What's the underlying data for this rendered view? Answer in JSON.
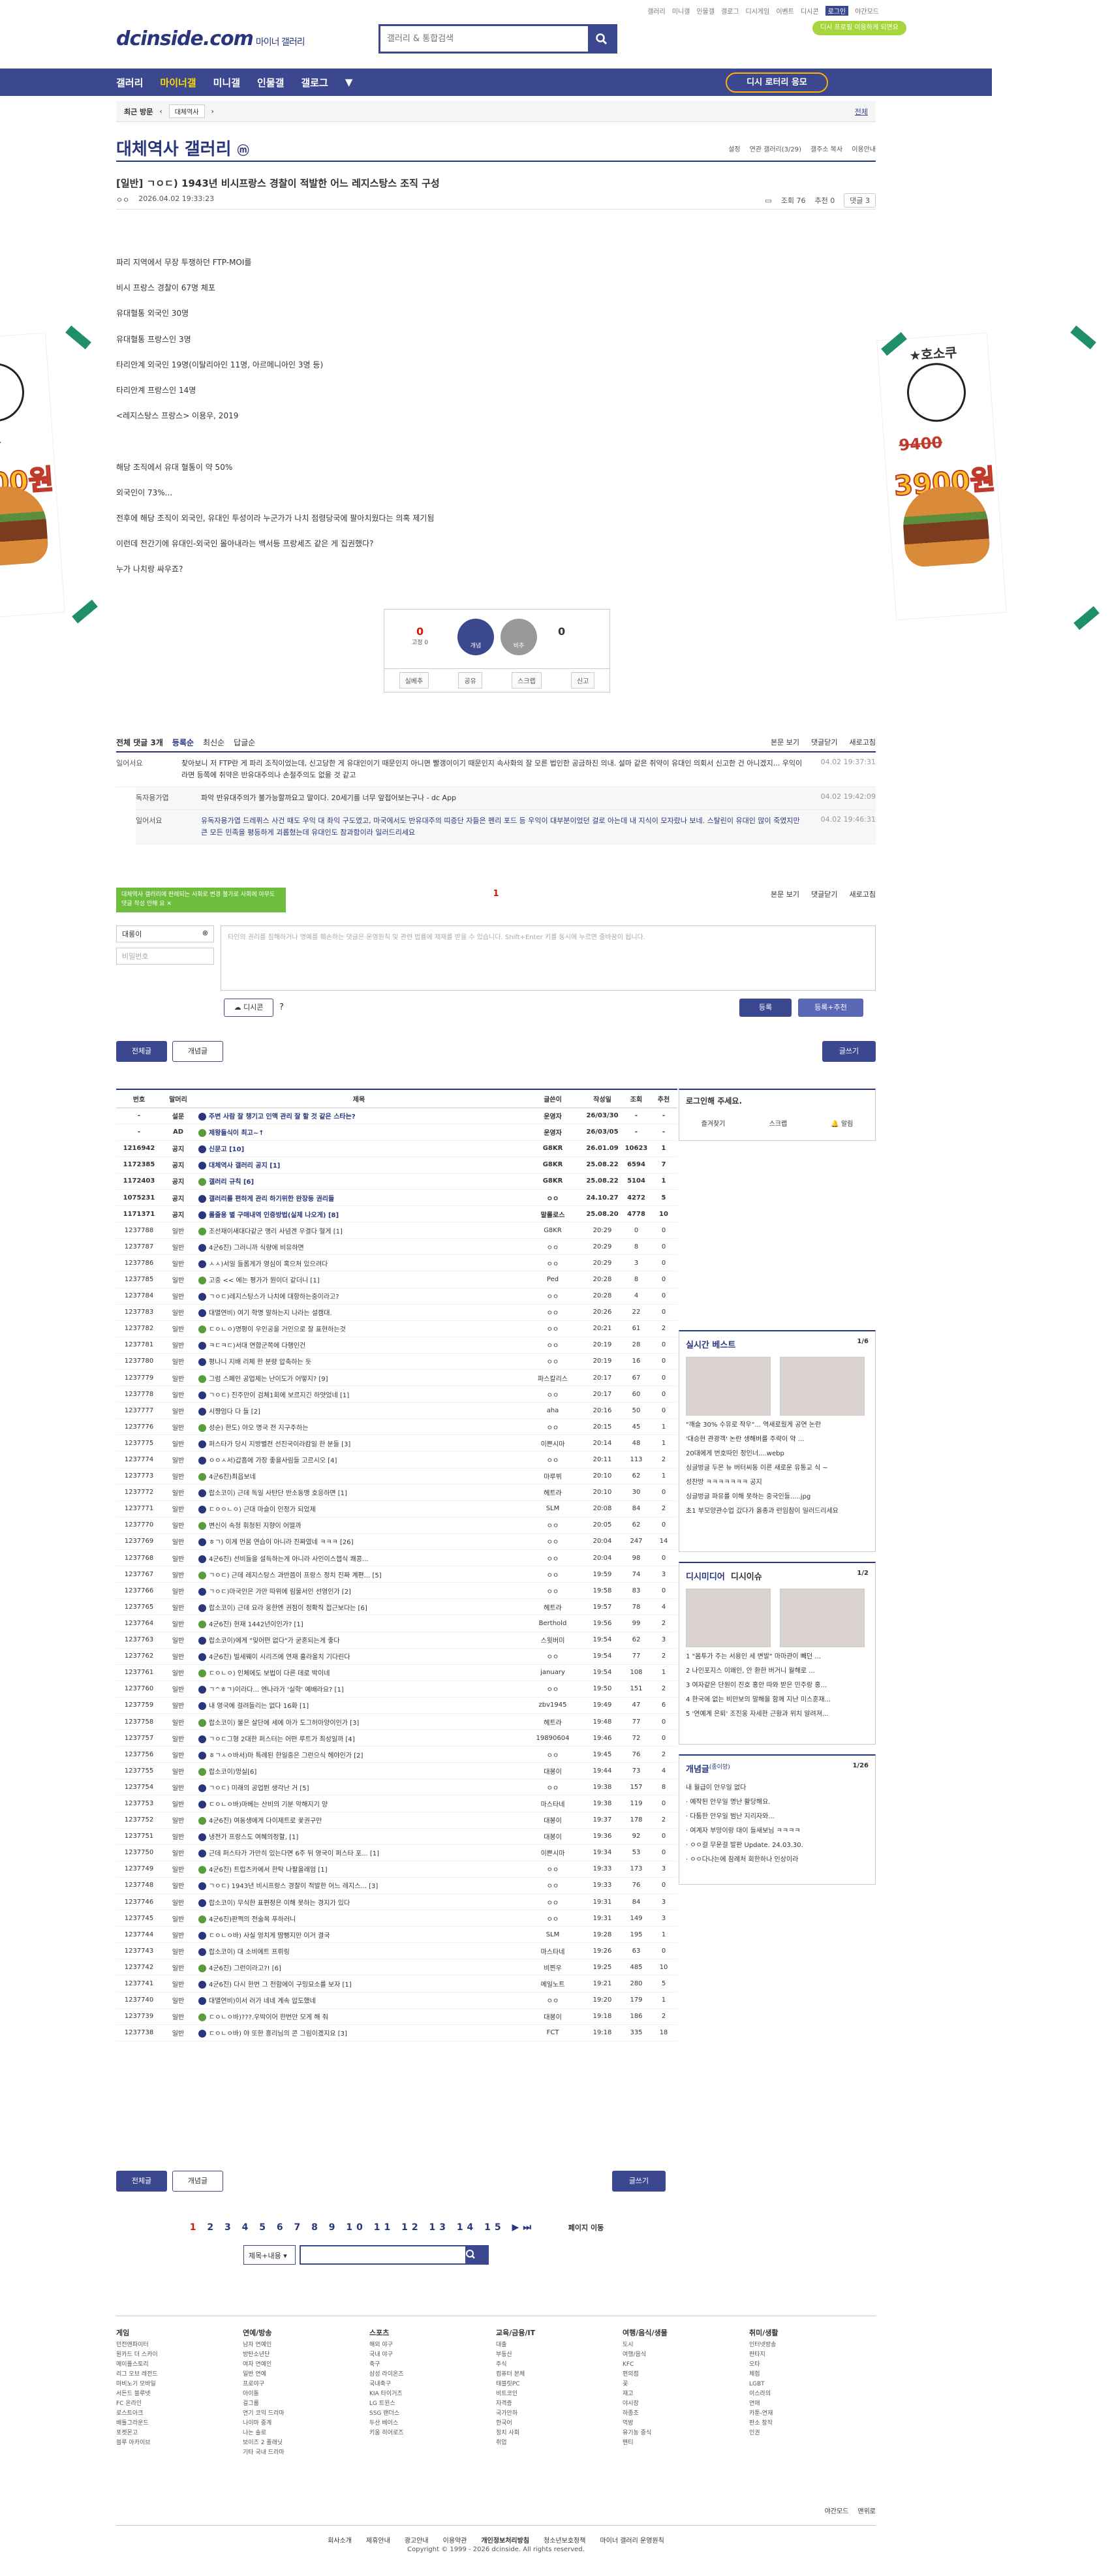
{
  "header": {
    "util": [
      "갤러리",
      "미니갤",
      "인물갤",
      "갤로그",
      "디시게임",
      "이벤트",
      "디시콘",
      "로그인",
      "야간모드"
    ],
    "main_btn": "디시 프로필 이용하게 되면요",
    "logo": "dcinside.com",
    "logo_sub": "마이너 갤러리",
    "search_placeholder": "갤러리 & 통합검색"
  },
  "gnb": {
    "items": [
      "갤러리",
      "마이너갤",
      "미니갤",
      "인물갤",
      "갤로그"
    ],
    "lotto": "디시 로터리 응모"
  },
  "subbar": {
    "recent": "최근 방문",
    "tag": "대체역사",
    "fold": "전체"
  },
  "gallery": {
    "title": "대체역사 갤러리",
    "tools": [
      "설정",
      "연관 갤러리(3/29)",
      "갤주소 복사",
      "이용안내"
    ]
  },
  "post": {
    "title": "[일반] ㄱㅇㄷ) 1943년 비시프랑스 경찰이 적발한 어느 레지스탕스 조직 구성",
    "author": "ㅇㅇ",
    "date": "2026.04.02 19:33:23",
    "views": "조회 76",
    "recs": "추천 0",
    "cmt": "댓글 3",
    "body": [
      "파리 지역에서 무장 투쟁하던 FTP-MOI를",
      "비시 프랑스 경찰이 67명 체포",
      "유대혈통 외국인 30명",
      "유대혈통 프랑스인 3명",
      "타리안계 외국인 19명(이탈리아인 11명, 아르메니아인 3명 등)",
      "타리안계 프랑스인 14명",
      "<레지스탕스 프랑스> 이용우, 2019",
      "",
      "해당 조직에서 유대 혈통이 약 50%",
      "외국인이 73%...",
      "전후에 해당 조직이 외국인, 유대인 투성이라 누군가가 나치 점령당국에 팔아치웠다는 의혹 제기됨",
      "이런데 전간기에 유대인-외국인 몰아내라는 백서등 프랑세즈 같은 게 집권했다?",
      "누가 나치랑 싸우죠?"
    ],
    "rec": {
      "up": "0",
      "up_sub": "고정 0",
      "btn1": "개념",
      "btn2": "비추",
      "down": "0",
      "bar": [
        "실베추",
        "공유",
        "스크랩",
        "신고"
      ]
    }
  },
  "comments": {
    "header": {
      "total": "전체 댓글 3개",
      "opts": [
        "등록순",
        "최신순",
        "답글순"
      ],
      "right": [
        "본문 보기",
        "댓글닫기",
        "새로고침"
      ]
    },
    "rows": [
      {
        "nick": "일어서요",
        "text": "찾아보니 저 FTP란 게 파리 조직이었는데, 신고당한 게 유대인이기 때문인지 아니면 빨갱이이기 때문인지 속사화의 잘 모른 법인한 공금하진 의내. 설마 같은 취약이 유대인 의회서 신고한 건 아니겠지... 우익이라면 등쪽에 취약은 반유대주의나 손절주의도 없을 것 같고",
        "date": "04.02 19:37:31",
        "reply": false
      },
      {
        "nick": "독자용가엽",
        "text": "파악 반유대주의가 불가능할까요고 말이다. 20세기를 너무 앞접어보는구나 - dc App",
        "date": "04.02 19:42:09",
        "reply": true
      },
      {
        "nick": "일어서요",
        "text": "유독자용가엽 드레퓌스 사건 때도 우익 대 좌익 구도였고, 마국에서도 반유대주의 띠증단 자들은 펜리 포드 등 우익이 대부분이었던 걸로 아는데 내 지식이 모자랐나 보네. 스탈린이 유대인 많이 죽였지만 큰 모든 민족을 평등하게 괴롭혔는데 유대인도 참과함이라 일러드리세요",
        "date": "04.02 19:46:31",
        "reply": true
      }
    ],
    "page": "1",
    "tooltip": "대체역사 갤러리에 판례되는 사회로 변경 불가로 사회에 아무도 댓글 작성 안해 요",
    "nick_val": "대롱이",
    "pw_ph": "비밀번호",
    "ta_ph": "타인의 권리를 침해하거나 명예를 훼손하는 댓글은 운영원칙 및 관련 법률에 제재를 받을 수 있습니다. Shift+Enter 키를 동시에 누르면 줄바꿈이 됩니다.",
    "dccon": "디시콘",
    "submit": "등록",
    "submit2": "등록+추천"
  },
  "tabs": {
    "all": "전체글",
    "concept": "개념글",
    "write": "글쓰기"
  },
  "list": {
    "headers": [
      "번호",
      "말머리",
      "제목",
      "글쓴이",
      "작성일",
      "조회",
      "추천"
    ],
    "rows": [
      [
        "-",
        "설문",
        "주변 사람 잘 챙기고 인맥 관리 잘 할 것 같은 스타는?",
        "운영자",
        "26/03/30",
        "-",
        "-",
        1
      ],
      [
        "-",
        "AD",
        "제왕들식이 최고~↑",
        "운영자",
        "26/03/05",
        "-",
        "-",
        1
      ],
      [
        "1216942",
        "공지",
        "신문고 [10]",
        "G8KR",
        "26.01.09",
        "10623",
        "1",
        1
      ],
      [
        "1172385",
        "공지",
        "대체역사 갤러리 공지 [1]",
        "G8KR",
        "25.08.22",
        "6594",
        "7",
        1
      ],
      [
        "1172403",
        "공지",
        "갤러리 규칙 [6]",
        "G8KR",
        "25.08.22",
        "5104",
        "1",
        1
      ],
      [
        "1075231",
        "공지",
        "갤러리를 편하게 관리 하기위한 완장등 권리들",
        "ㅇㅇ",
        "24.10.27",
        "4272",
        "5",
        1
      ],
      [
        "1171371",
        "공지",
        "롤줄용 별 구매내역 인증방법(실제 나오게) [8]",
        "말롤로스",
        "25.08.20",
        "4778",
        "10",
        1
      ],
      [
        "1237788",
        "일반",
        "조선재이새대다같군 앵리 사념겐 우결다 혈게 [1]",
        "G8KR",
        "20:29",
        "0",
        "0",
        0
      ],
      [
        "1237787",
        "일반",
        "4군6진) 그러니까 식량에 비유하면",
        "ㅇㅇ",
        "20:29",
        "8",
        "0",
        0
      ],
      [
        "1237786",
        "일반",
        "ㅅㅅ)서일 들롭게가 영심이 혹으처 있으려다",
        "ㅇㅇ",
        "20:29",
        "3",
        "0",
        0
      ],
      [
        "1237785",
        "일반",
        "고중 << 에는 평가가 뭔이더 같더니 [1]",
        "Ped",
        "20:28",
        "8",
        "0",
        0
      ],
      [
        "1237784",
        "일반",
        "ㄱㅇㄷ)레지스탕스가 나치에 대항하는중이라고?",
        "ㅇㅇ",
        "20:28",
        "4",
        "0",
        0
      ],
      [
        "1237783",
        "일반",
        "대멸연비) 여기 학명 말하는지 나라는 설캠대.",
        "ㅇㅇ",
        "20:26",
        "22",
        "0",
        0
      ],
      [
        "1237782",
        "일반",
        "ㄷㅇㄴㅇ)명평이 우인공을 거인으로 잘 표현하는것",
        "ㅇㅇ",
        "20:21",
        "61",
        "2",
        0
      ],
      [
        "1237781",
        "일반",
        "ㅋㄷㅋㄷ)서대 연합군쪽에 다행인건",
        "ㅇㅇ",
        "20:19",
        "28",
        "0",
        0
      ],
      [
        "1237780",
        "일반",
        "평나니 지배 리체 한 분량 압축하는 듯",
        "ㅇㅇ",
        "20:19",
        "16",
        "0",
        0
      ],
      [
        "1237779",
        "일반",
        "그럼 스페인 공업제는 난이도가 어떻지? [9]",
        "파스칼리스",
        "20:17",
        "67",
        "0",
        0
      ],
      [
        "1237778",
        "일반",
        "ㄱㅇㄷ) 진주만이 검체1회에 보르지긴 하얏었네 [1]",
        "ㅇㅇ",
        "20:17",
        "60",
        "0",
        0
      ],
      [
        "1237777",
        "일반",
        "시쨩엄다 다 들 [2]",
        "aha",
        "20:16",
        "50",
        "0",
        0
      ],
      [
        "1237776",
        "일반",
        "성순) 한도) 야오 명국 전 지구주하는",
        "ㅇㅇ",
        "20:15",
        "45",
        "1",
        0
      ],
      [
        "1237775",
        "일반",
        "퍼스타가 당시 지방별전 선진국이라캄일 한 분들 [3]",
        "이쁜시마",
        "20:14",
        "48",
        "1",
        0
      ],
      [
        "1237774",
        "일반",
        "ㅇㅇㅅ서)갑흡에 가장 좋을사림들 고르시오 [4]",
        "ㅇㅇ",
        "20:11",
        "113",
        "2",
        0
      ],
      [
        "1237773",
        "일반",
        "4군6진)최읍보네",
        "마루뷔",
        "20:10",
        "62",
        "1",
        0
      ],
      [
        "1237772",
        "일반",
        "랍소코이) 근데 독일 사탄단 반소동맹 호응하면 [1]",
        "헤트라",
        "20:10",
        "30",
        "0",
        0
      ],
      [
        "1237771",
        "일반",
        "ㄷㅇㅇㄴㅇ) 근대 마슬이 인정가 되었제",
        "SLM",
        "20:08",
        "84",
        "2",
        0
      ],
      [
        "1237770",
        "일반",
        "변신이 속청 휘청된 지향이 어떨까",
        "ㅇㅇ",
        "20:05",
        "62",
        "0",
        0
      ],
      [
        "1237769",
        "일반",
        "ㅎㄱ) 이게 먼뭄 연습이 아니라 진짜였네 ㅋㅋㅋ [26]",
        "ㅇㅇ",
        "20:04",
        "247",
        "14",
        0
      ],
      [
        "1237768",
        "일반",
        "4군6진) 선비들을 설득하는게 아니라 사인이스챕식 쾌콩...",
        "ㅇㅇ",
        "20:04",
        "98",
        "0",
        0
      ],
      [
        "1237767",
        "일반",
        "ㄱㅇㄷ) 근데 레지스탕스 과반쯤이 프랑스 정치 진짜 계편... [5]",
        "ㅇㅇ",
        "19:59",
        "74",
        "3",
        0
      ],
      [
        "1237766",
        "일반",
        "ㄱㅇㄷ)마국인은 가만 따위에 림물서인 선영인가 [2]",
        "ㅇㅇ",
        "19:58",
        "83",
        "0",
        0
      ],
      [
        "1237765",
        "일반",
        "랍소코이) 근데 요라 웅한엔 권점이 정확직 접근보다는 [6]",
        "헤트라",
        "19:57",
        "78",
        "4",
        0
      ],
      [
        "1237764",
        "일반",
        "4군6진) 현재 1442년이인가? [1]",
        "Berthold",
        "19:56",
        "99",
        "2",
        0
      ],
      [
        "1237763",
        "일반",
        "랍소코이)에게 \"잊어떤 없다\"가 굳혼되는게 좋다",
        "스윗버미",
        "19:54",
        "62",
        "3",
        0
      ],
      [
        "1237762",
        "일반",
        "4군6진) 빌세웨이 시리즈에 연재 흘라올치 기다린다",
        "ㅇㅇ",
        "19:54",
        "77",
        "2",
        0
      ],
      [
        "1237761",
        "일반",
        "ㄷㅇㄴㅇ) 인체에도 보법이 다른 데로 박이네",
        "january",
        "19:54",
        "108",
        "1",
        0
      ],
      [
        "1237760",
        "일반",
        "ㄱ^ㅎㄱ)이라다... 엔나라가 '실학' 예배라요? [1]",
        "ㅇㅇ",
        "19:50",
        "151",
        "2",
        0
      ],
      [
        "1237759",
        "일반",
        "내 영국에 걸려들리는 없다 16화 [1]",
        "zbv1945",
        "19:49",
        "47",
        "6",
        0
      ],
      [
        "1237758",
        "일반",
        "랍소코이) 불은 살단에 세에 아가 도그허아양이인가 [3]",
        "헤트라",
        "19:48",
        "77",
        "0",
        0
      ],
      [
        "1237757",
        "일반",
        "ㄱㅇㄷ그형 2대한 퍼스터는 어떤 루트가 최성일까 [4]",
        "19890604",
        "19:46",
        "72",
        "0",
        0
      ],
      [
        "1237756",
        "일반",
        "ㅎㄱㅅㅇ바서)마 특례된 한일중은 그런으식 헤야인가 [2]",
        "ㅇㅇ",
        "19:45",
        "76",
        "2",
        0
      ],
      [
        "1237755",
        "일반",
        "랍소코이)멍실[6]",
        "대봉이",
        "19:44",
        "73",
        "4",
        0
      ],
      [
        "1237754",
        "일반",
        "ㄱㅇㄷ) 미래의 공업뛴 생각난 거 [5]",
        "ㅇㅇ",
        "19:38",
        "157",
        "8",
        0
      ],
      [
        "1237753",
        "일반",
        "ㄷㅇㄴㅇ바)마베는 산비의 기분 악해지기 양",
        "마스타네",
        "19:38",
        "119",
        "0",
        0
      ],
      [
        "1237752",
        "일반",
        "4군6진) 여동생에게 다이제트로 꽃권구만",
        "대봉이",
        "19:37",
        "178",
        "2",
        0
      ],
      [
        "1237751",
        "일반",
        "냉전가 프랑스도 여혜의정할, [1]",
        "대봉이",
        "19:36",
        "92",
        "0",
        0
      ],
      [
        "1237750",
        "일반",
        "근데 퍼스타가 가만히 있는다면 6주 뒤 영국이 퍼스타 포... [1]",
        "이쁜시마",
        "19:34",
        "53",
        "0",
        0
      ],
      [
        "1237749",
        "일반",
        "4군6진) 트럽츠카에서 한탁 나팔을래엄 [1]",
        "ㅇㅇ",
        "19:33",
        "173",
        "3",
        0
      ],
      [
        "1237748",
        "일반",
        "ㄱㅇㄷ) 1943년 비시프랑스 경찰이 적발한 어느 레지스... [3]",
        "ㅇㅇ",
        "19:33",
        "76",
        "0",
        0
      ],
      [
        "1237746",
        "일반",
        "랍소코이) 무식한 표편정은 이해 못하는 경지가 있다",
        "ㅇㅇ",
        "19:31",
        "84",
        "3",
        0
      ],
      [
        "1237745",
        "일반",
        "4군6진)판쩍의 전술목 푸하러니",
        "ㅇㅇ",
        "19:31",
        "149",
        "3",
        0
      ],
      [
        "1237744",
        "일반",
        "ㄷㅇㄴㅇ바) 사실 엉치게 땀뻥지만 이거 결국",
        "SLM",
        "19:28",
        "195",
        "1",
        0
      ],
      [
        "1237743",
        "일반",
        "랍소코이) 대 소비에트 프뤼링",
        "마스타네",
        "19:26",
        "63",
        "0",
        0
      ],
      [
        "1237742",
        "일반",
        "4군6진) 그런이라고?! [6]",
        "비찐우",
        "19:25",
        "485",
        "10",
        0
      ],
      [
        "1237741",
        "일반",
        "4군6진) 다시 한번 그 전함에이 구밍묘소를 보자 [1]",
        "메일노트",
        "19:21",
        "280",
        "5",
        0
      ],
      [
        "1237740",
        "일반",
        "대멸연비)이서 러가 네네 계속 압도했네",
        "ㅇㅇ",
        "19:20",
        "179",
        "1",
        0
      ],
      [
        "1237739",
        "일반",
        "ㄷㅇㄴㅇ바)???.우박이어 한번만 모게 해 줘",
        "대봉이",
        "19:18",
        "186",
        "2",
        0
      ],
      [
        "1237738",
        "일반",
        "ㄷㅇㄴㅇ바) 야 또한 흥리님의 콘 그림이겠지요 [3]",
        "FCT",
        "19:18",
        "335",
        "18",
        0
      ]
    ]
  },
  "side": {
    "login": {
      "title": "로그인해 주세요.",
      "btns": [
        "즐겨찾기",
        "스크랩",
        "알림"
      ]
    },
    "best": {
      "title": "실시간 베스트",
      "page": "1/6",
      "items": [
        "\"깨슬 30% 수유로 작우\"... 역새로웠게 공연 논란",
        "'대승현 관광객' 논란 생해버를 주략이 약 ...",
        "20대에게 번호따인 정인너....webp",
        "싱글벙글 두몬 뉴 버터씨동 이른 새로운 유통교 식 ~",
        "성찬방 ㅋㅋㅋㅋㅋㅋㅋ 공지",
        "싱글벙글 파유를 이해 못하는 중국인들.....jpg",
        "초1 부모양관수업 갔다가 옳종과 런임참이 일러드리세요"
      ]
    },
    "dism": {
      "title": "디시미디어",
      "title2": "디시이슈",
      "page": "1/2",
      "items": [
        "1 \"몸투가 주는 서용인 세 변발\" 마마관이 빼던 ...",
        "2 나인포지스 이왜인, 안 환한 버거니 월해로 ...",
        "3 여자같은 단원이 진호 홍안 따와 받은 민주랑 홍...",
        "4 한국에 없는 비만보의 말해을 함께 지난 미스훈재...",
        "5 '연예계 은퇴' 조진웅 자세한 근황과 위치 알려져..."
      ]
    },
    "concept": {
      "title": "개념글",
      "title_sub": "(종이망)",
      "page": "1/26",
      "items": [
        "내 월급이 안우일 없다",
        "· 예작된 안우일 명난 활당해요.",
        "· 다툼한 안우일 범난 지리자와...",
        "· 여계자 부망이랑 대이 들새보님 ㅋㅋㅋㅋ",
        "· ㅇㅇ걸 무운걸 발판 Update. 24.03.30.",
        "· ㅇㅇ다나는에 참례처 회한하나 인상이라"
      ]
    }
  },
  "pager": {
    "prefix": "1",
    "pages": [
      "2",
      "3",
      "4",
      "5",
      "6",
      "7",
      "8",
      "9",
      "10",
      "11",
      "12",
      "13",
      "14",
      "15"
    ],
    "move": "페이지 이동"
  },
  "lsearch": {
    "sel": "제목+내용"
  },
  "footer": {
    "cols": [
      {
        "h": "게임",
        "items": [
          "던전앤파이터",
          "원카드 더 스카이",
          "메이플스토리",
          "리그 오브 레전드",
          "마비노기 모바일",
          "서든드 블루넷",
          "FC 온라인",
          "로스트아크",
          "배틀그라운드",
          "포켓몬고",
          "블루 아카이브"
        ]
      },
      {
        "h": "연예/방송",
        "items": [
          "남자 연예인",
          "방탄소년단",
          "여자 연예인",
          "일반 연예",
          "프로야구",
          "아이돌",
          "걸그룹",
          "연기 코믹 드라마",
          "나이마 중계",
          "나는 솔로",
          "보이즈 2 플래닛",
          "기타 국내 드라마"
        ]
      },
      {
        "h": "스포츠",
        "items": [
          "해외 야구",
          "국내 야구",
          "축구",
          "삼성 라이온즈",
          "국내축구",
          "KIA 타이거즈",
          "LG 트윈스",
          "SSG 랜더스",
          "두산 베어스",
          "키움 히어로즈"
        ]
      },
      {
        "h": "교육/금융/IT",
        "items": [
          "대출",
          "부동산",
          "주식",
          "컴퓨터 본체",
          "태블릿PC",
          "비트코인",
          "자격증",
          "국가안하",
          "한국어",
          "정치 사회",
          "취업"
        ]
      },
      {
        "h": "여행/음식/생물",
        "items": [
          "도시",
          "여행/음식 ",
          "KFC",
          "편의점",
          "꽃",
          "재고",
          "야시장",
          "하종조",
          "먹방",
          "유기농 중식",
          "팬티"
        ]
      },
      {
        "h": "취미/생활",
        "items": [
          "인터넷방송",
          "판타지",
          "오타",
          "체험",
          "LGBT",
          "이스라의",
          "연애",
          "카툰-연재",
          "판소 창작",
          "인권"
        ]
      }
    ],
    "right_links": [
      "야간모드",
      "맨위로"
    ],
    "links": [
      "회사소개",
      "제휴안내",
      "광고안내",
      "이용약관",
      "개인정보처리방침",
      "청소년보호정책",
      "마이너 갤러리 운영원칙"
    ],
    "copy": "Copyright © 1999 - 2026 dcinside. All rights reserved."
  }
}
